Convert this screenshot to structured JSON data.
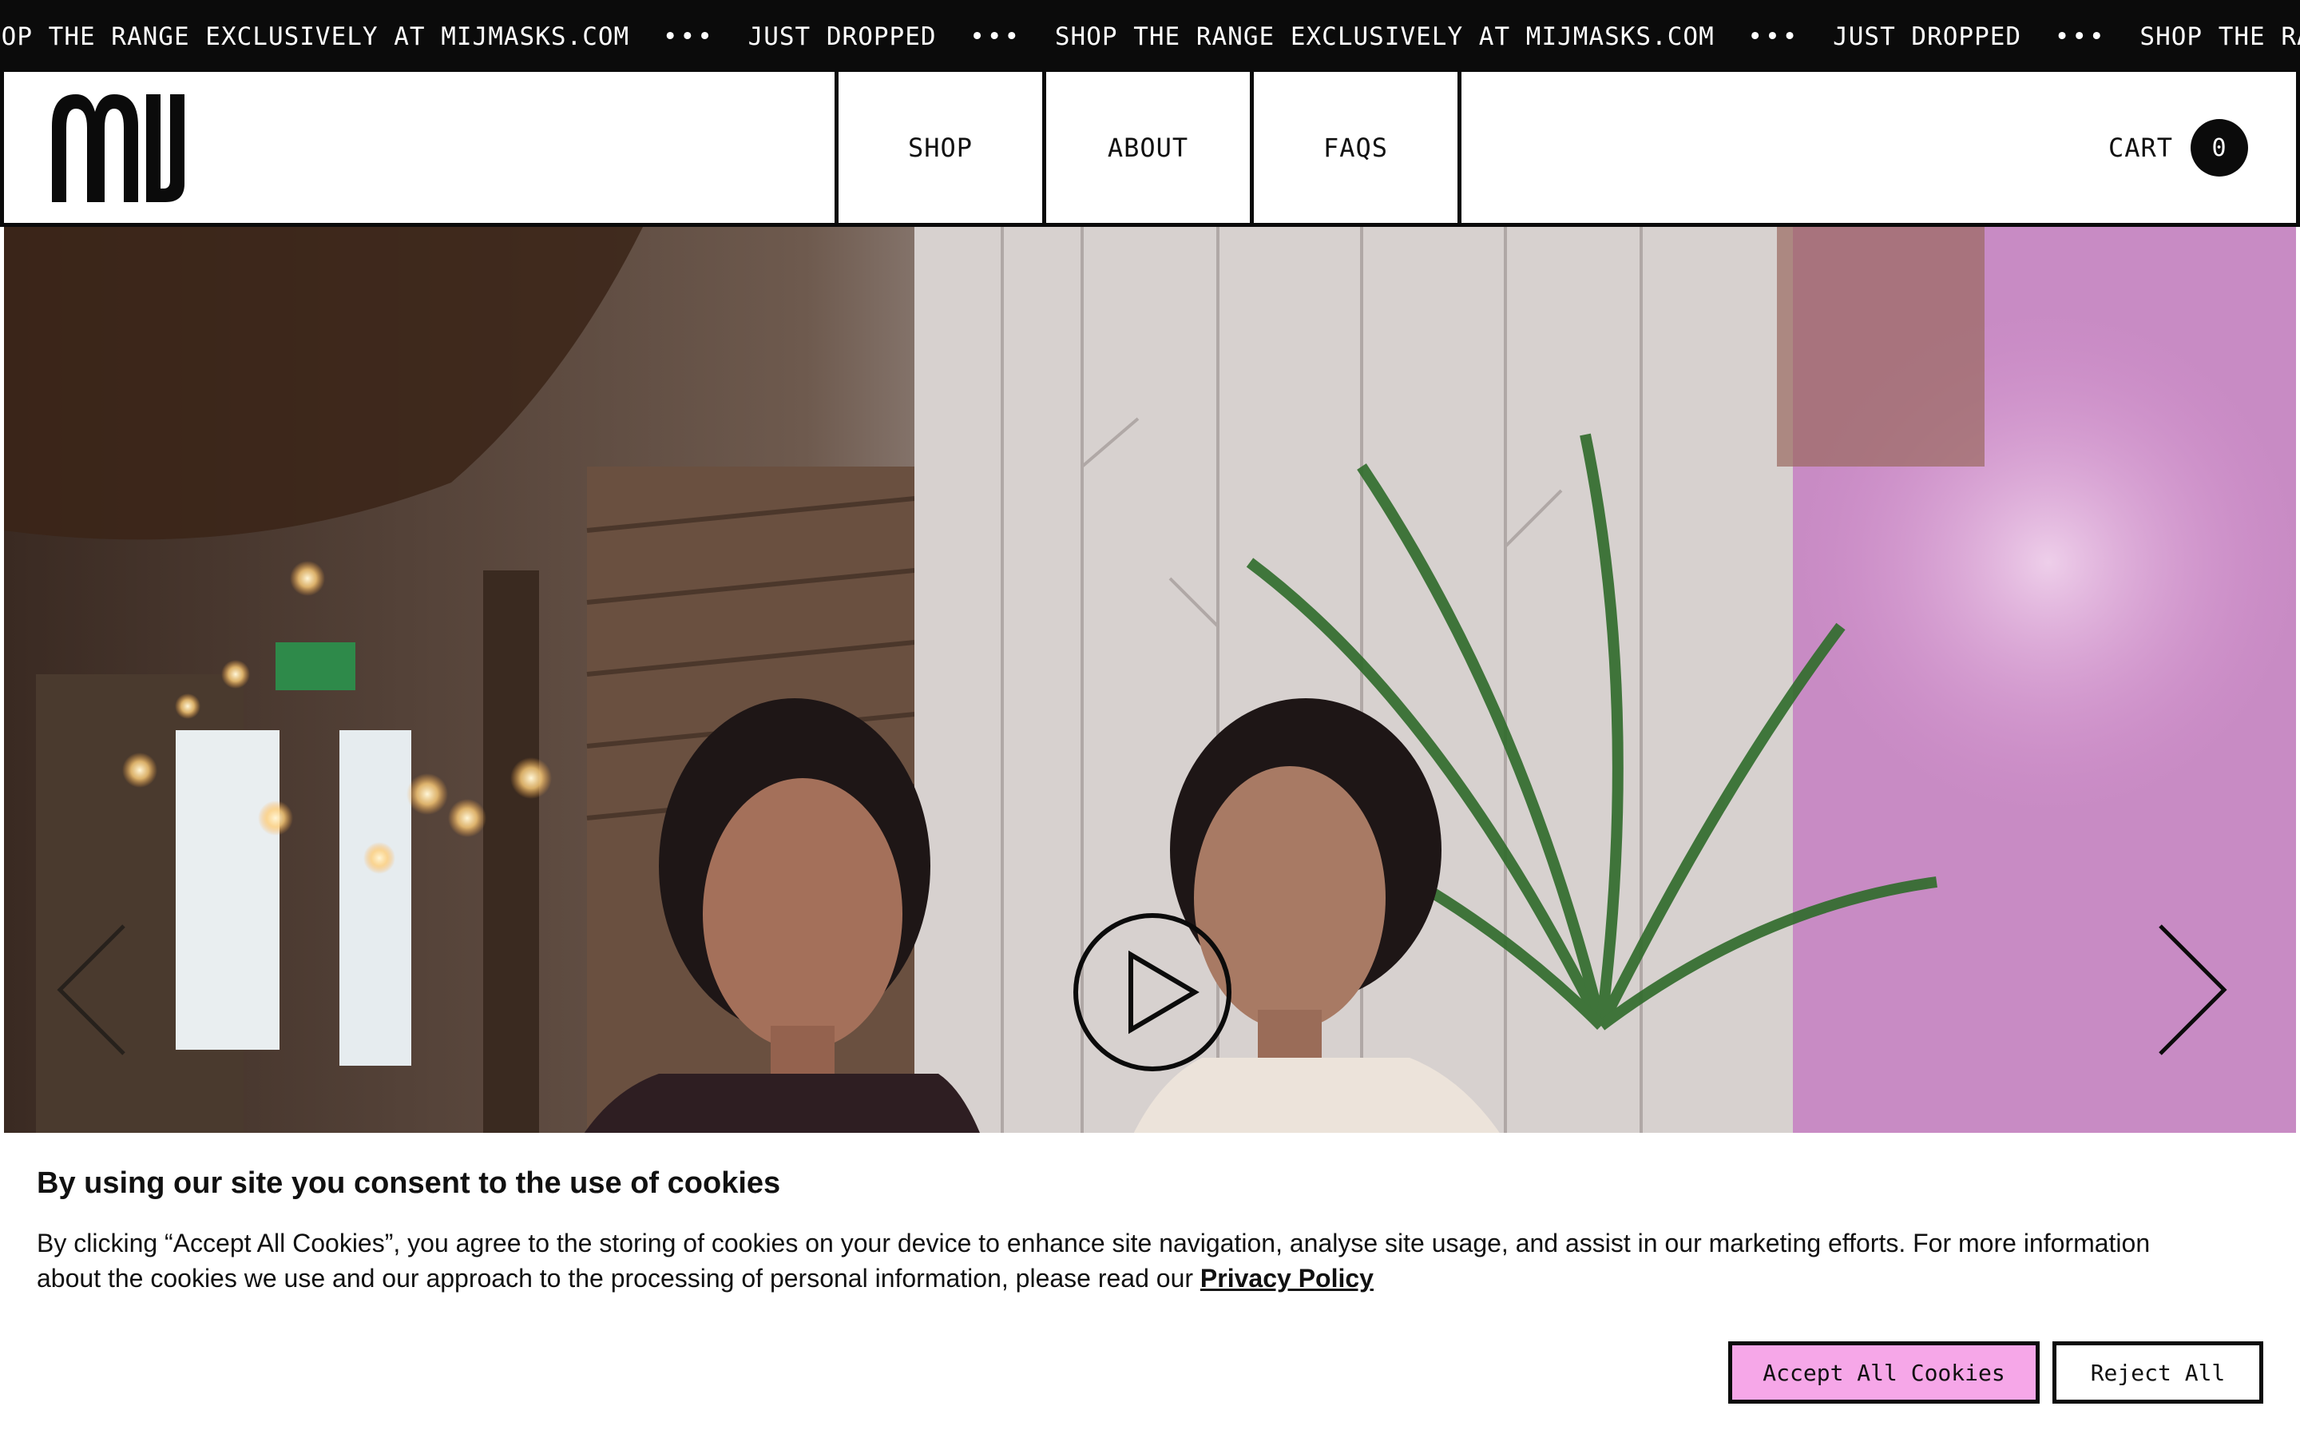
{
  "ticker": {
    "items": [
      "HOP THE RANGE EXCLUSIVELY AT MIJMASKS.COM",
      "•••",
      "JUST DROPPED",
      "•••",
      "SHOP THE RANGE EXCLUSIVELY AT MIJMASKS.COM",
      "•••",
      "JUST DROPPED",
      "•••",
      "SHOP THE RANGE EX"
    ]
  },
  "header": {
    "logo_text": "MIJ",
    "nav": {
      "shop": "SHOP",
      "about": "ABOUT",
      "faqs": "FAQS"
    },
    "cart_label": "CART",
    "cart_count": "0"
  },
  "hero": {
    "play_icon": "play-icon",
    "prev_icon": "chevron-left-icon",
    "next_icon": "chevron-right-icon"
  },
  "cookie": {
    "title": "By using our site you consent to the use of cookies",
    "body": "By clicking “Accept All Cookies”, you agree to the storing of cookies on your device to enhance site navigation, analyse site usage, and assist in our marketing efforts. For more information about the cookies we use and our approach to the processing of personal information, please read our ",
    "privacy_link": "Privacy Policy",
    "accept_label": "Accept All Cookies",
    "reject_label": "Reject All"
  },
  "colors": {
    "black": "#0b0b0b",
    "accept_button": "#f6a7e8",
    "white": "#ffffff"
  }
}
